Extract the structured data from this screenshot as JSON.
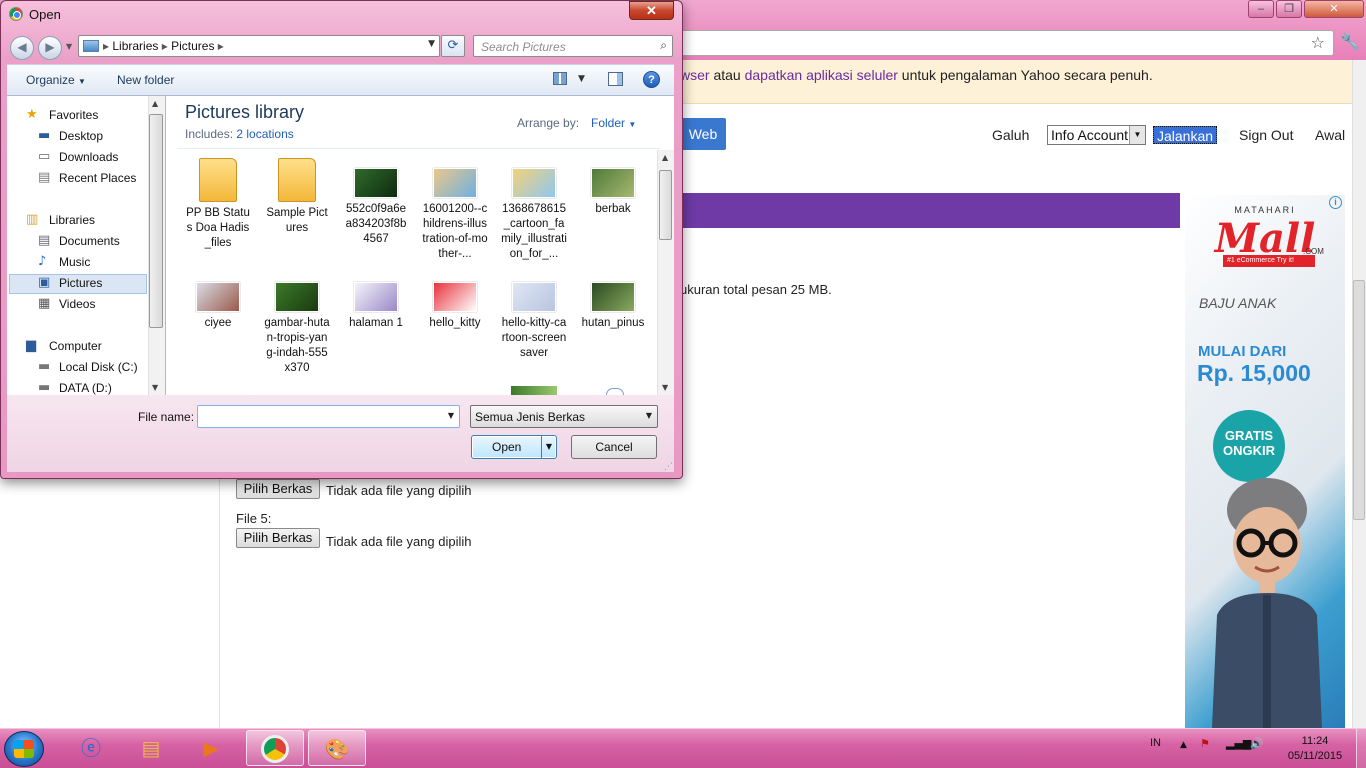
{
  "browser": {
    "banner": {
      "part1": "wser",
      "part2": " atau ",
      "link": "dapatkan aplikasi seluler",
      "part3": " untuk pengalaman Yahoo secara penuh."
    },
    "web_button": "Web",
    "nav": {
      "user": "Galuh",
      "select_value": "Info Account",
      "jalankan": "Jalankan",
      "sign_out": "Sign Out",
      "awal": "Awal"
    },
    "quota_text": "ukuran total pesan 25 MB.",
    "file4": {
      "button": "Pilih Berkas",
      "status": "Tidak ada file yang dipilih"
    },
    "file5": {
      "label": "File 5:",
      "button": "Pilih Berkas",
      "status": "Tidak ada file yang dipilih"
    }
  },
  "ad": {
    "brand_top": "MATAHARI",
    "brand": "Mall",
    "brand_com": ".COM",
    "badge": "#1 eCommerce  Try it!",
    "category": "BAJU ANAK",
    "mulai": "MULAI DARI",
    "price": "Rp. 15,000",
    "gratis1": "GRATIS",
    "gratis2": "ONGKIR"
  },
  "dialog": {
    "title": "Open",
    "close": "✕",
    "address": [
      "Libraries",
      "Pictures"
    ],
    "search_placeholder": "Search Pictures",
    "toolbar": {
      "organize": "Organize",
      "new_folder": "New folder"
    },
    "nav": [
      {
        "label": "Favorites",
        "icon": "star-icon",
        "glyph": "★",
        "color": "#e8a400",
        "group": true
      },
      {
        "label": "Desktop",
        "icon": "desktop-icon",
        "glyph": "▬",
        "color": "#2c5d9a"
      },
      {
        "label": "Downloads",
        "icon": "downloads-icon",
        "glyph": "▭",
        "color": "#666"
      },
      {
        "label": "Recent Places",
        "icon": "recent-places-icon",
        "glyph": "▤",
        "color": "#777"
      },
      {
        "label": "Libraries",
        "icon": "libraries-icon",
        "glyph": "▥",
        "color": "#d8a43a",
        "group": true
      },
      {
        "label": "Documents",
        "icon": "documents-icon",
        "glyph": "▤",
        "color": "#667"
      },
      {
        "label": "Music",
        "icon": "music-icon",
        "glyph": "♪",
        "color": "#2a6ab0"
      },
      {
        "label": "Pictures",
        "icon": "pictures-icon",
        "glyph": "▣",
        "color": "#2c5d9a",
        "selected": true
      },
      {
        "label": "Videos",
        "icon": "videos-icon",
        "glyph": "▦",
        "color": "#555"
      },
      {
        "label": "Computer",
        "icon": "computer-icon",
        "glyph": "▆",
        "color": "#2c5d9a",
        "group": true
      },
      {
        "label": "Local Disk (C:)",
        "icon": "disk-icon",
        "glyph": "▬",
        "color": "#777"
      },
      {
        "label": "DATA (D:)",
        "icon": "disk-icon",
        "glyph": "▬",
        "color": "#777"
      }
    ],
    "library_title": "Pictures library",
    "includes_label": "Includes: ",
    "includes_link": "2 locations",
    "arrange_label": "Arrange by:",
    "arrange_value": "Folder",
    "files": [
      {
        "name": "PP BB Status Doa Hadis_files",
        "kind": "folder",
        "colors": [
          "#ffe08a",
          "#f4b73a"
        ]
      },
      {
        "name": "Sample Pictures",
        "kind": "folder",
        "colors": [
          "#ffe08a",
          "#f4b73a"
        ]
      },
      {
        "name": "552c0f9a6ea834203f8b4567",
        "kind": "image",
        "colors": [
          "#2f6b2a",
          "#0f2a12"
        ]
      },
      {
        "name": "16001200--childrens-illustration-of-mother-...",
        "kind": "image",
        "colors": [
          "#e9c88a",
          "#6fb0e0"
        ]
      },
      {
        "name": "1368678615_cartoon_family_illustration_for_...",
        "kind": "image",
        "colors": [
          "#f2d27a",
          "#8fc7ef"
        ]
      },
      {
        "name": "berbak",
        "kind": "image",
        "colors": [
          "#4f7a3a",
          "#a8b870"
        ]
      },
      {
        "name": "ciyee",
        "kind": "image",
        "colors": [
          "#d9dce6",
          "#9a5a4a"
        ]
      },
      {
        "name": "gambar-hutan-tropis-yang-indah-555x370",
        "kind": "image",
        "colors": [
          "#3c7a2a",
          "#1a3a10"
        ]
      },
      {
        "name": "halaman 1",
        "kind": "image",
        "colors": [
          "#f4f4fa",
          "#9a88c8"
        ]
      },
      {
        "name": "hello_kitty",
        "kind": "image",
        "colors": [
          "#e8323c",
          "#ffffff"
        ]
      },
      {
        "name": "hello-kitty-cartoon-screensaver",
        "kind": "image",
        "colors": [
          "#dfe6f4",
          "#b8c4e0"
        ]
      },
      {
        "name": "hutan_pinus",
        "kind": "image",
        "colors": [
          "#2a4a22",
          "#8aaa60"
        ]
      }
    ],
    "file_name_label": "File name:",
    "file_name_value": "",
    "file_type": "Semua Jenis Berkas",
    "open_button": "Open",
    "cancel_button": "Cancel"
  },
  "taskbar": {
    "apps": [
      "windows-explorer",
      "internet-explorer",
      "file-explorer",
      "media-player",
      "chrome",
      "paint"
    ],
    "lang": "IN",
    "time": "11:24",
    "date": "05/11/2015"
  }
}
